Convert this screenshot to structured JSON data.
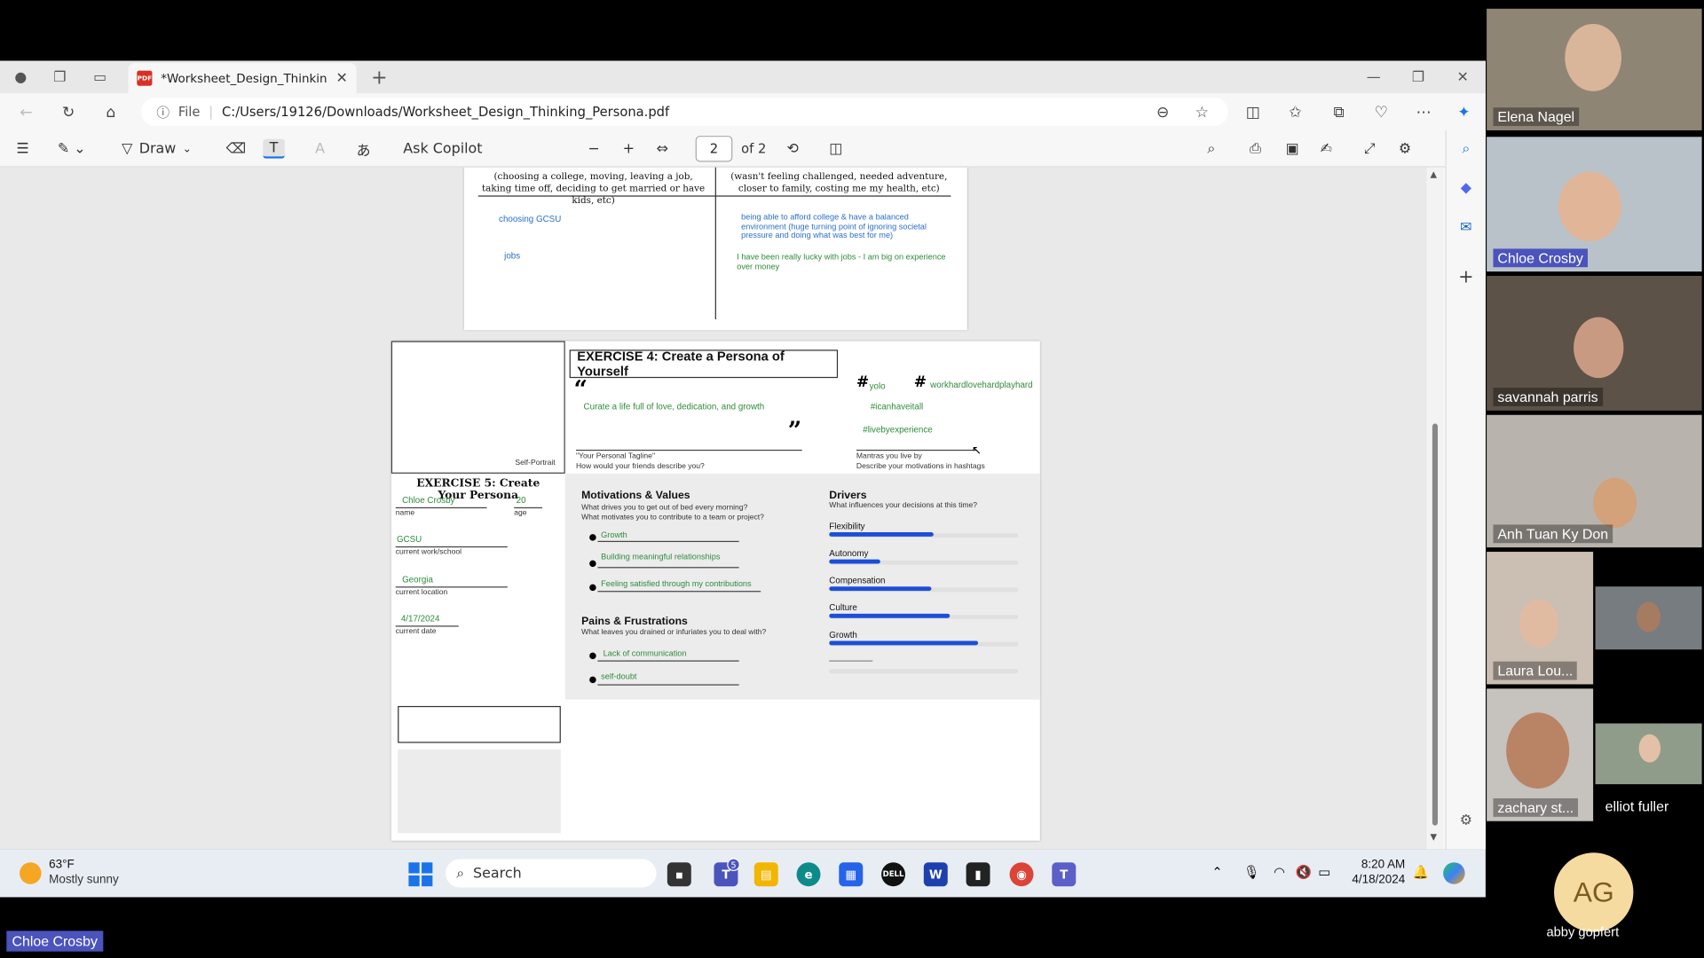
{
  "browser": {
    "tab_title": "*Worksheet_Design_Thinking_Pe",
    "address_label": "File",
    "address": "C:/Users/19126/Downloads/Worksheet_Design_Thinking_Persona.pdf"
  },
  "pdf_toolbar": {
    "draw_label": "Draw",
    "ask_copilot": "Ask Copilot",
    "page_current": "2",
    "page_total": "of 2"
  },
  "page1": {
    "left_header": "(choosing a college, moving, leaving a job, taking time off, deciding to get married or have kids, etc)",
    "right_header": "(wasn't feeling challenged, needed adventure, closer to family, costing me my health, etc)",
    "entry1": "choosing GCSU",
    "entry2": "jobs",
    "reason1": "being able to afford college & have a balanced environment (huge turning point of ignoring societal pressure and doing what was best for me)",
    "reason2": "I have been really lucky with jobs - I am big on experience over money"
  },
  "page2": {
    "self_portrait": "Self-Portrait",
    "ex4_title": "EXERCISE 4: Create a Persona of Yourself",
    "open_quote": "“",
    "close_quote": "”",
    "tagline": "Curate a life full of love, dedication, and growth",
    "tagline_label1": "\"Your Personal Tagline\"",
    "tagline_label2": "How would your friends describe you?",
    "hash_symbol": "#",
    "hashtag1": "yolo",
    "hashtag2": "workhardlovehardplayhard",
    "hashtag3": "#icanhaveitall",
    "hashtag4": "#livebyexperience",
    "mantra_label1": "Mantras you live by",
    "mantra_label2": "Describe your motivations in hashtags",
    "ex5_title": "EXERCISE 5: Create Your Persona",
    "name_value": "Chloe Crosby",
    "name_label": "name",
    "age_value": "20",
    "age_label": "age",
    "work_value": "GCSU",
    "work_label": "current work/school",
    "location_value": "Georgia",
    "location_label": "current location",
    "date_value": "4/17/2024",
    "date_label": "current date",
    "mv_title": "Motivations & Values",
    "mv_q1": "What drives you to get out of bed every morning?",
    "mv_q2": "What motivates you to contribute to a team or project?",
    "mv_items": [
      "Growth",
      "Building meaningful relationships",
      "Feeling satisfied through my contributions"
    ],
    "pf_title": "Pains & Frustrations",
    "pf_q": "What leaves you drained or infuriates you to deal with?",
    "pf_items": [
      "Lack of communication",
      "self-doubt"
    ],
    "drivers_title": "Drivers",
    "drivers_q": "What influences your decisions at this time?",
    "drivers": [
      {
        "label": "Flexibility",
        "level": 0.55
      },
      {
        "label": "Autonomy",
        "level": 0.27
      },
      {
        "label": "Compensation",
        "level": 0.54
      },
      {
        "label": "Culture",
        "level": 0.64
      },
      {
        "label": "Growth",
        "level": 0.79
      }
    ]
  },
  "taskbar": {
    "temp": "63°F",
    "weather": "Mostly sunny",
    "search": "Search",
    "time": "8:20 AM",
    "date": "4/18/2024",
    "teams_badge": "5"
  },
  "participants": {
    "p1": "Elena Nagel",
    "p2": "Chloe Crosby",
    "p3": "savannah parris",
    "p4": "Anh Tuan Ky Don",
    "p5": "Laura Lou...",
    "p6": "zachary st...",
    "p7": "elliot fuller",
    "p8_initials": "AG",
    "p8": "abby gopfert",
    "speaker": "Chloe Crosby"
  },
  "colors": {
    "accent": "#1d4ed8",
    "handwriting_green": "#2e8b3a",
    "handwriting_blue": "#2a6fc9"
  }
}
